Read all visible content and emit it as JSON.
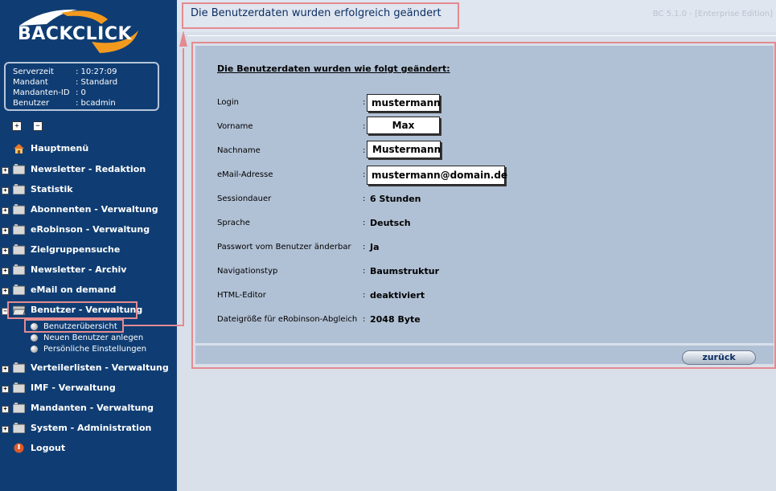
{
  "logo": {
    "text": "BACKCLICK"
  },
  "info": {
    "rows": [
      {
        "label": "Serverzeit",
        "value": ": 10:27:09"
      },
      {
        "label": "Mandant",
        "value": ": Standard"
      },
      {
        "label": "Mandanten-ID",
        "value": ": 0"
      },
      {
        "label": "Benutzer",
        "value": ": bcadmin"
      }
    ]
  },
  "tree_controls": {
    "expand_all": "+",
    "collapse_all": "−"
  },
  "nav": {
    "home": "Hauptmenü",
    "items": [
      {
        "label": "Newsletter - Redaktion",
        "toggle": "+"
      },
      {
        "label": "Statistik",
        "toggle": "+"
      },
      {
        "label": "Abonnenten - Verwaltung",
        "toggle": "+"
      },
      {
        "label": "eRobinson - Verwaltung",
        "toggle": "+"
      },
      {
        "label": "Zielgruppensuche",
        "toggle": "+"
      },
      {
        "label": "Newsletter - Archiv",
        "toggle": "+"
      },
      {
        "label": "eMail on demand",
        "toggle": "+"
      },
      {
        "label": "Benutzer - Verwaltung",
        "toggle": "−"
      },
      {
        "label": "Verteilerlisten - Verwaltung",
        "toggle": "+"
      },
      {
        "label": "IMF - Verwaltung",
        "toggle": "+"
      },
      {
        "label": "Mandanten - Verwaltung",
        "toggle": "+"
      },
      {
        "label": "System - Administration",
        "toggle": "+"
      }
    ],
    "sub_items": [
      "Benutzerübersicht",
      "Neuen Benutzer anlegen",
      "Persönliche Einstellungen"
    ],
    "logout": "Logout"
  },
  "header": {
    "title": "Die Benutzerdaten wurden erfolgreich geändert",
    "version": "BC 5.1.0 - [Enterprise Edition]"
  },
  "details": {
    "heading": "Die Benutzerdaten wurden wie folgt geändert:",
    "rows": [
      {
        "label": "Login",
        "value": "mustermann"
      },
      {
        "label": "Vorname",
        "value": "Max"
      },
      {
        "label": "Nachname",
        "value": "Mustermann"
      },
      {
        "label": "eMail-Adresse",
        "value": "mustermann@domain.de"
      },
      {
        "label": "Sessiondauer",
        "value": "6 Stunden"
      },
      {
        "label": "Sprache",
        "value": "Deutsch"
      },
      {
        "label": "Passwort vom Benutzer änderbar",
        "value": "Ja"
      },
      {
        "label": "Navigationstyp",
        "value": "Baumstruktur"
      },
      {
        "label": "HTML-Editor",
        "value": "deaktiviert"
      },
      {
        "label": "Dateigröße für eRobinson-Abgleich",
        "value": "2048 Byte"
      }
    ],
    "colon": ":"
  },
  "actions": {
    "back_label": "zurück"
  },
  "colors": {
    "sidebar": "#0f3d73",
    "panel": "#b1c1d5",
    "highlight": "#e48a90",
    "title": "#0c2e63"
  }
}
